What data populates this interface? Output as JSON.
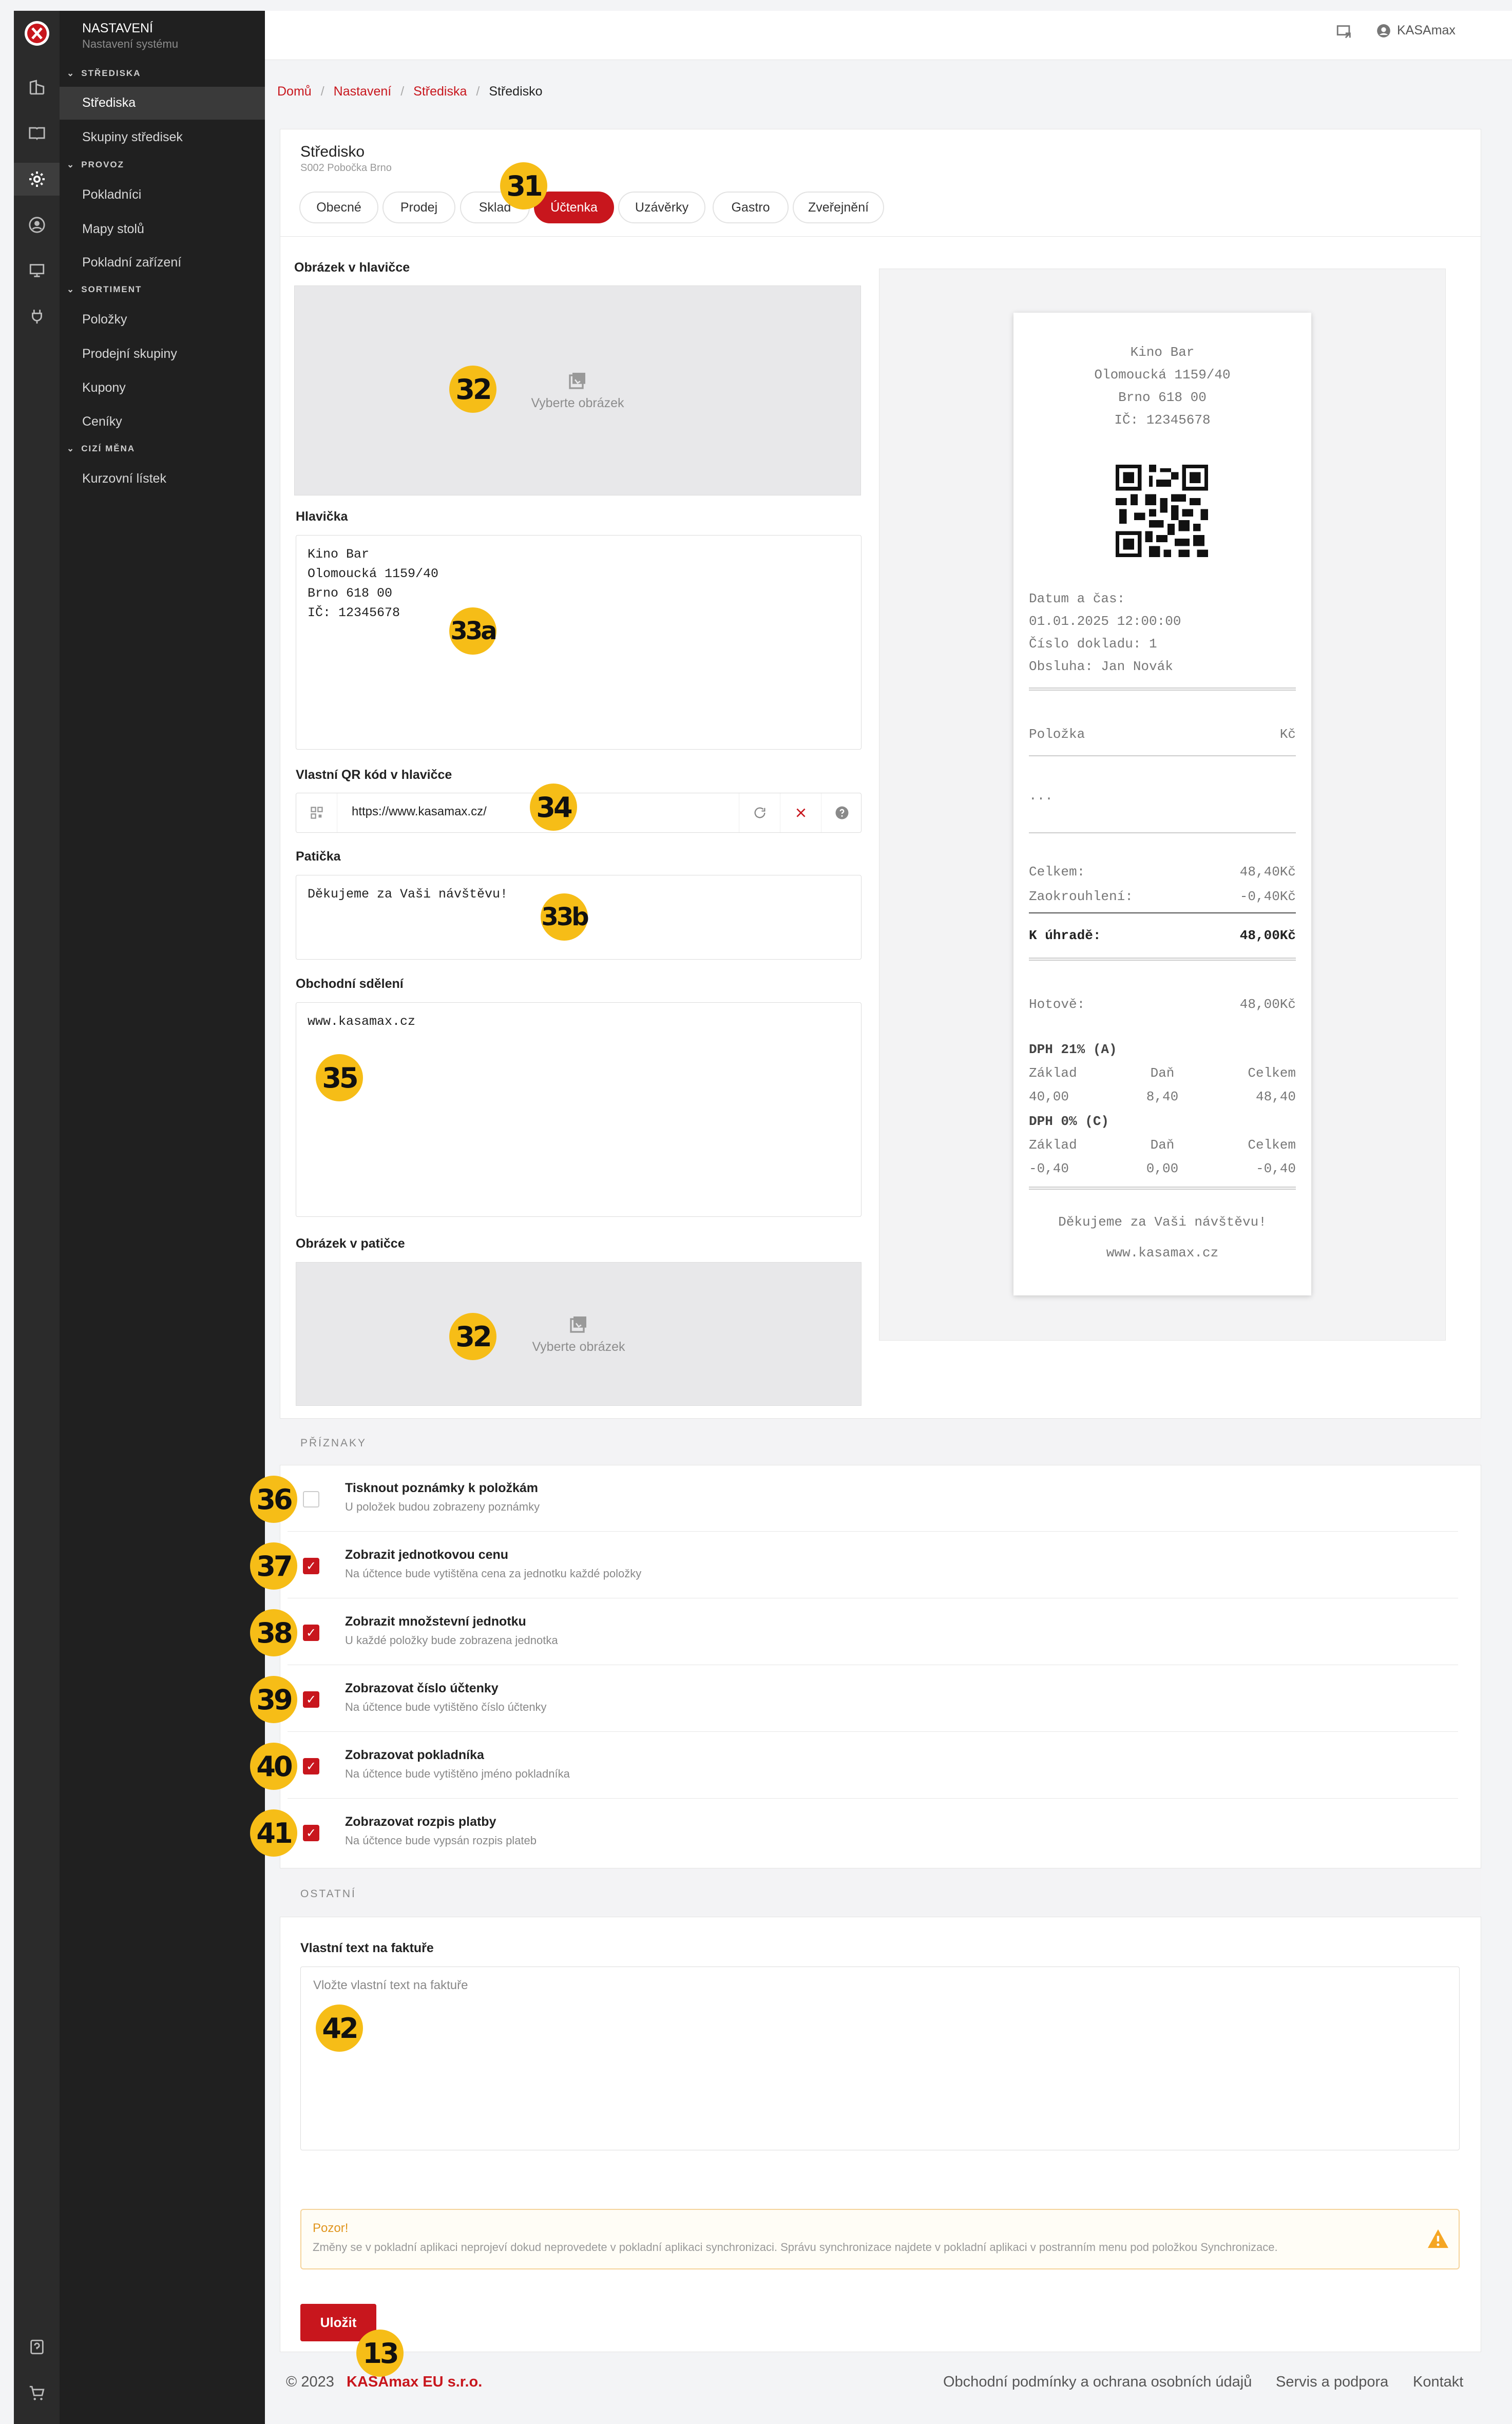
{
  "app": {
    "section_title": "NASTAVENÍ",
    "section_subtitle": "Nastavení systému"
  },
  "sidebar": {
    "sections": [
      {
        "label": "STŘEDISKA",
        "items": [
          "Střediska",
          "Skupiny středisek"
        ]
      },
      {
        "label": "PROVOZ",
        "items": [
          "Pokladníci",
          "Mapy stolů",
          "Pokladní zařízení"
        ]
      },
      {
        "label": "SORTIMENT",
        "items": [
          "Položky",
          "Prodejní skupiny",
          "Kupony",
          "Ceníky"
        ]
      },
      {
        "label": "CIZÍ MĚNA",
        "items": [
          "Kurzovní lístek"
        ]
      }
    ]
  },
  "topbar": {
    "user_name": "KASAmax"
  },
  "breadcrumb": [
    "Domů",
    "Nastavení",
    "Střediska",
    "Středisko"
  ],
  "page": {
    "title": "Středisko",
    "subtitle": "S002 Pobočka Brno"
  },
  "tabs": [
    "Obecné",
    "Prodej",
    "Sklad",
    "Účtenka",
    "Uzávěrky",
    "Gastro",
    "Zveřejnění"
  ],
  "active_tab": "Účtenka",
  "form": {
    "header_image_label": "Obrázek v hlavičce",
    "header_image_placeholder": "Vyberte obrázek",
    "header_label": "Hlavička",
    "header_text": "Kino Bar\nOlomoucká 1159/40\nBrno 618 00\nIČ: 12345678",
    "qr_label": "Vlastní QR kód v hlavičce",
    "qr_value": "https://www.kasamax.cz/",
    "footer_label": "Patička",
    "footer_text": "Děkujeme za Vaši návštěvu!",
    "business_label": "Obchodní sdělení",
    "business_text": "www.kasamax.cz",
    "footer_image_label": "Obrázek v patičce",
    "footer_image_placeholder": "Vyberte obrázek"
  },
  "receipt": {
    "header_lines": [
      "Kino Bar",
      "Olomoucká 1159/40",
      "Brno 618 00",
      "IČ: 12345678"
    ],
    "datetime_label": "Datum a čas:",
    "datetime": "01.01.2025 12:00:00",
    "doc_number": "Číslo dokladu: 1",
    "served_by": "Obsluha: Jan Novák",
    "col_item": "Položka",
    "col_currency": "Kč",
    "items_placeholder": "...",
    "total_label": "Celkem:",
    "total_value": "48,40Kč",
    "rounding_label": "Zaokrouhlení:",
    "rounding_value": "-0,40Kč",
    "to_pay_label": "K úhradě:",
    "to_pay_value": "48,00Kč",
    "cash_label": "Hotově:",
    "cash_value": "48,00Kč",
    "vat_groups": [
      {
        "title": "DPH 21% (A)",
        "base": "40,00",
        "tax": "8,40",
        "total": "48,40"
      },
      {
        "title": "DPH 0% (C)",
        "base": "-0,40",
        "tax": "0,00",
        "total": "-0,40"
      }
    ],
    "vat_cols": [
      "Základ",
      "Daň",
      "Celkem"
    ],
    "thanks": "Děkujeme za Vaši návštěvu!",
    "web": "www.kasamax.cz"
  },
  "flags_section": "PŘÍZNAKY",
  "flags": [
    {
      "title": "Tisknout poznámky k položkám",
      "desc": "U položek budou zobrazeny poznámky",
      "checked": false
    },
    {
      "title": "Zobrazit jednotkovou cenu",
      "desc": "Na účtence bude vytištěna cena za jednotku každé položky",
      "checked": true
    },
    {
      "title": "Zobrazit množstevní jednotku",
      "desc": "U každé položky bude zobrazena jednotka",
      "checked": true
    },
    {
      "title": "Zobrazovat číslo účtenky",
      "desc": "Na účtence bude vytištěno číslo účtenky",
      "checked": true
    },
    {
      "title": "Zobrazovat pokladníka",
      "desc": "Na účtence bude vytištěno jméno pokladníka",
      "checked": true
    },
    {
      "title": "Zobrazovat rozpis platby",
      "desc": "Na účtence bude vypsán rozpis plateb",
      "checked": true
    }
  ],
  "other_section": "OSTATNÍ",
  "invoice": {
    "label": "Vlastní text na faktuře",
    "placeholder": "Vložte vlastní text na faktuře"
  },
  "warning": {
    "title": "Pozor!",
    "text": "Změny se v pokladní aplikaci neprojeví dokud neprovedete v pokladní aplikaci synchronizaci. Správu synchronizace najdete v pokladní aplikaci v postranním menu pod položkou Synchronizace."
  },
  "save_label": "Uložit",
  "footer": {
    "copyright": "© 2023",
    "company": "KASAmax EU s.r.o.",
    "links": [
      "Obchodní podmínky a ochrana osobních údajů",
      "Servis a podpora",
      "Kontakt"
    ]
  },
  "callouts": {
    "tabs": "31",
    "image_top": "32",
    "header": "33a",
    "qr": "34",
    "footer_text": "33b",
    "business": "35",
    "image_bottom": "32",
    "flag1": "36",
    "flag2": "37",
    "flag3": "38",
    "flag4": "39",
    "flag5": "40",
    "flag6": "41",
    "invoice": "42",
    "save": "13"
  },
  "colors": {
    "accent": "#c8161d",
    "callout": "#f6bd17",
    "sidebar": "#202020",
    "rail": "#2b2b2b",
    "warning": "#f5a623"
  }
}
